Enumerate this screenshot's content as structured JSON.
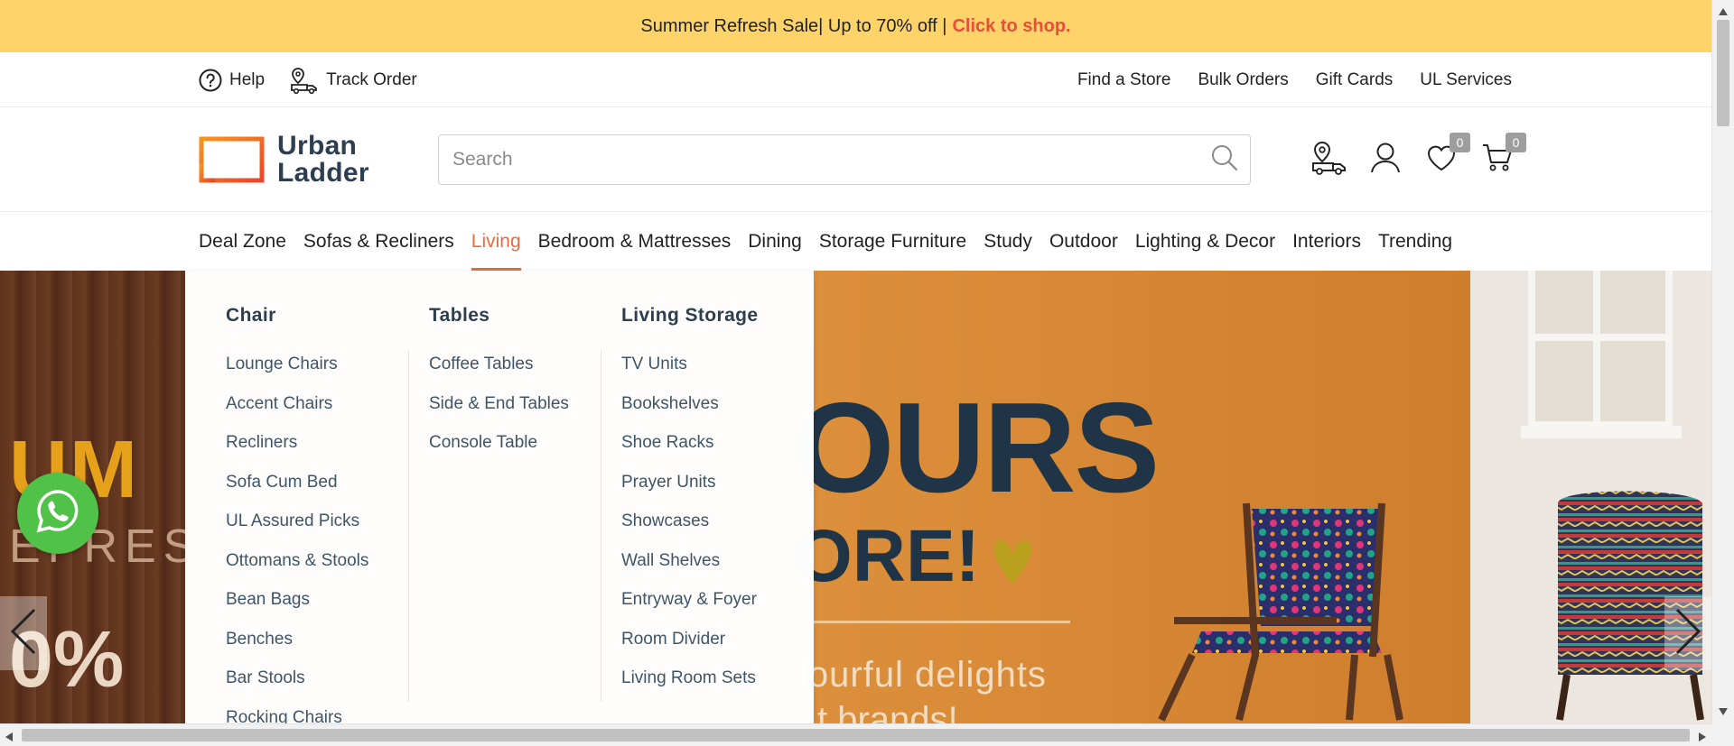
{
  "promo": {
    "text": "Summer Refresh Sale| Up to 70% off | ",
    "cta": "Click to shop."
  },
  "utility": {
    "help": "Help",
    "track_order": "Track Order",
    "links": [
      "Find a Store",
      "Bulk Orders",
      "Gift Cards",
      "UL Services"
    ]
  },
  "header": {
    "logo_line1": "Urban",
    "logo_line2": "Ladder",
    "search_placeholder": "Search",
    "wishlist_count": "0",
    "cart_count": "0"
  },
  "nav": {
    "items": [
      "Deal Zone",
      "Sofas & Recliners",
      "Living",
      "Bedroom & Mattresses",
      "Dining",
      "Storage Furniture",
      "Study",
      "Outdoor",
      "Lighting & Decor",
      "Interiors",
      "Trending"
    ],
    "active": "Living"
  },
  "mega_menu": {
    "columns": [
      {
        "title": "Chair",
        "items": [
          "Lounge Chairs",
          "Accent Chairs",
          "Recliners",
          "Sofa Cum Bed",
          "UL Assured Picks",
          "Ottomans & Stools",
          "Bean Bags",
          "Benches",
          "Bar Stools",
          "Rocking Chairs"
        ]
      },
      {
        "title": "Tables",
        "items": [
          "Coffee Tables",
          "Side & End Tables",
          "Console Table"
        ]
      },
      {
        "title": "Living Storage",
        "items": [
          "TV Units",
          "Bookshelves",
          "Shoe Racks",
          "Prayer Units",
          "Showcases",
          "Wall Shelves",
          "Entryway & Foyer",
          "Room Divider",
          "Living Room Sets"
        ]
      }
    ]
  },
  "hero": {
    "left_big": "UM",
    "left_sub": "EFRES",
    "left_pct": "0%",
    "headline": "OURS",
    "headline2": "ORE!",
    "tagline": "lourful delights",
    "tagline2": "t brands!"
  },
  "colors": {
    "promo_bg": "#fdd36a",
    "accent": "#e86c3f",
    "cta": "#e94d3c",
    "brand_text": "#2c3e50",
    "whatsapp": "#4fc247"
  }
}
